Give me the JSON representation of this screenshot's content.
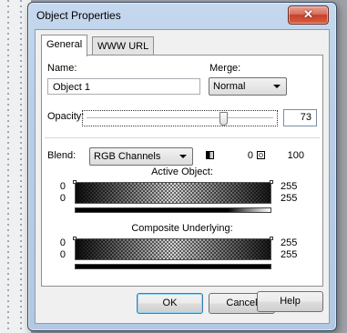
{
  "window": {
    "title": "Object Properties",
    "close_glyph": "✕"
  },
  "tabs": [
    {
      "label": "General",
      "active": true
    },
    {
      "label": "WWW URL",
      "active": false
    }
  ],
  "general": {
    "name_label": "Name:",
    "name_value": "Object 1",
    "merge_label": "Merge:",
    "merge_value": "Normal",
    "opacity_label": "Opacity:",
    "opacity_value": "73",
    "opacity_fraction": 0.73,
    "blend_label": "Blend:",
    "blend_value": "RGB Channels",
    "blend_low": "0",
    "blend_high": "100"
  },
  "active_object": {
    "title": "Active Object:",
    "left_top": "0",
    "left_bottom": "0",
    "right_top": "255",
    "right_bottom": "255"
  },
  "composite": {
    "title": "Composite Underlying:",
    "left_top": "0",
    "left_bottom": "0",
    "right_top": "255",
    "right_bottom": "255"
  },
  "buttons": {
    "ok": "OK",
    "cancel": "Cancel",
    "help": "Help"
  },
  "colors": {
    "title_bar": "#b9cfe8",
    "close_button": "#c7402b"
  }
}
